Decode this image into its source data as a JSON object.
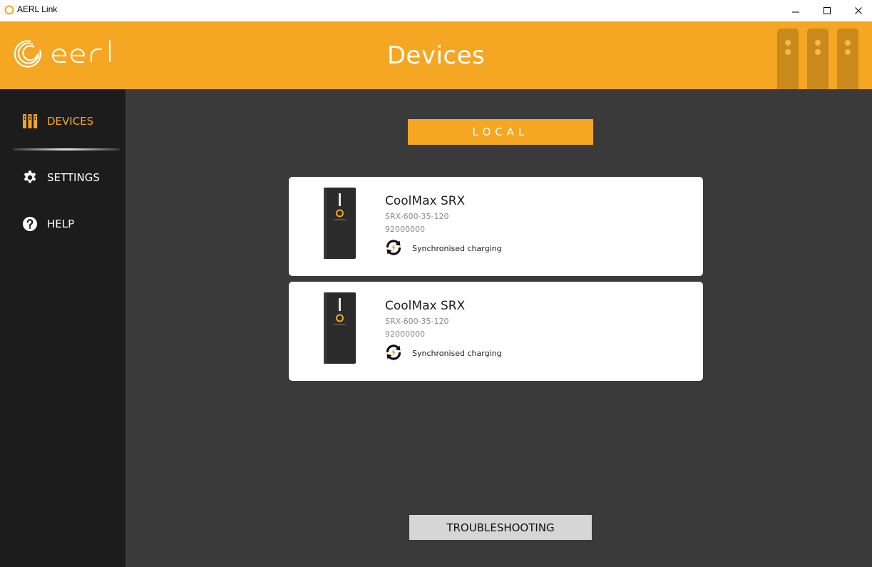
{
  "window": {
    "title": "AERL Link"
  },
  "header": {
    "title": "Devices",
    "logo_text": "aerl",
    "color": "#f5a623"
  },
  "sidebar": {
    "items": [
      {
        "label": "DEVICES",
        "icon": "devices-icon",
        "active": true
      },
      {
        "label": "SETTINGS",
        "icon": "gear-icon",
        "active": false
      },
      {
        "label": "HELP",
        "icon": "help-icon",
        "active": false
      }
    ]
  },
  "main": {
    "section_label": "LOCAL",
    "devices": [
      {
        "name": "CoolMax SRX",
        "model": "SRX-600-35-120",
        "serial": "92000000",
        "status": "Synchronised charging",
        "status_icon": "sync-charging-icon"
      },
      {
        "name": "CoolMax SRX",
        "model": "SRX-600-35-120",
        "serial": "92000000",
        "status": "Synchronised charging",
        "status_icon": "sync-charging-icon"
      }
    ],
    "troubleshooting_label": "TROUBLESHOOTING"
  },
  "colors": {
    "accent": "#f5a623",
    "sidebar_bg": "#1c1c1c",
    "main_bg": "#3a3a3b"
  }
}
